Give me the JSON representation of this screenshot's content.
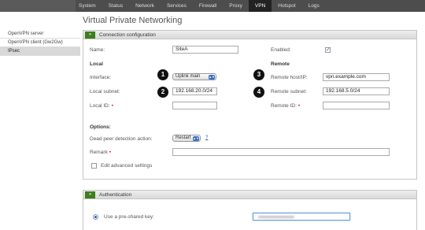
{
  "topnav": {
    "items": [
      "System",
      "Status",
      "Network",
      "Services",
      "Firewall",
      "Proxy",
      "VPN",
      "Hotspot",
      "Logs"
    ],
    "active": "VPN"
  },
  "page_title": "Virtual Private Networking",
  "sidebar": {
    "items": [
      "OpenVPN server",
      "OpenVPN client (Gw2Gw)",
      "IPsec"
    ],
    "active": "IPsec"
  },
  "connection": {
    "title": "Connection configuration",
    "toggle": "»",
    "name_label": "Name:",
    "name_value": "SiteA",
    "enabled_label": "Enabled:",
    "enabled_checked": true,
    "local_heading": "Local",
    "remote_heading": "Remote",
    "interface_label": "Interface:",
    "interface_value": "Uplink main",
    "remote_host_label": "Remote host/IP:",
    "remote_host_value": "vpn.example.com",
    "local_subnet_label": "Local subnet:",
    "local_subnet_value": "192.168.20.0/24",
    "remote_subnet_label": "Remote subnet:",
    "remote_subnet_value": "192.168.5.0/24",
    "local_id_label": "Local ID:",
    "remote_id_label": "Remote ID:",
    "required_mark": "•",
    "options_heading": "Options:",
    "dpd_label": "Dead peer detection action:",
    "dpd_value": "Restart",
    "help_link": "?",
    "remark_label": "Remark",
    "advanced_label": "Edit advanced settings",
    "advanced_checked": false,
    "select_arrows": "▲▼"
  },
  "callouts": [
    "1",
    "2",
    "3",
    "4"
  ],
  "authentication": {
    "title": "Authentication",
    "toggle": "»",
    "psk_label": "Use a pre-shared key:",
    "psk_selected": true
  }
}
